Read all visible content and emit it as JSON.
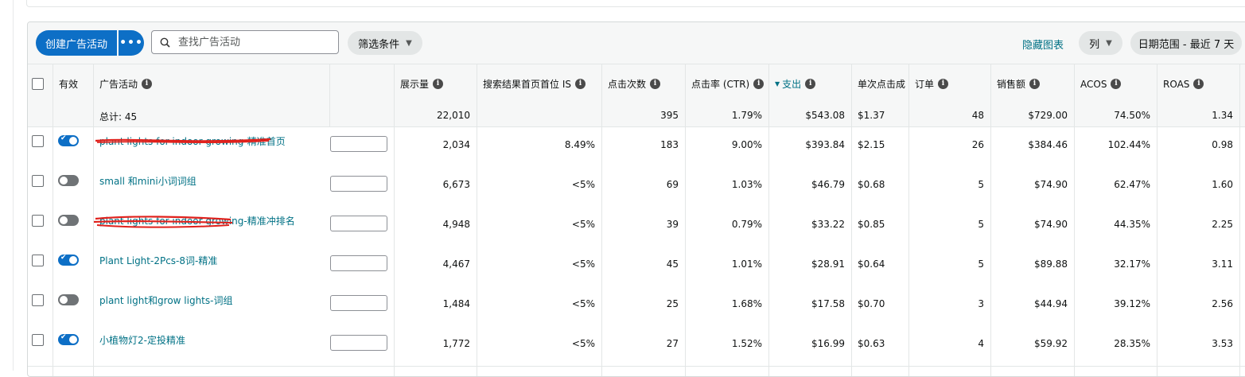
{
  "toolbar": {
    "create_label": "创建广告活动",
    "more_label": "•••",
    "search_placeholder": "查找广告活动",
    "filter_label": "筛选条件",
    "hide_chart_label": "隐藏图表",
    "columns_label": "列",
    "date_range_label": "日期范围 - 最近 7 天"
  },
  "table": {
    "headers": {
      "active": "有效",
      "campaign": "广告活动",
      "impressions": "展示量",
      "top_of_search_is": "搜索结果首页首位 IS",
      "clicks": "点击次数",
      "ctr": "点击率 (CTR)",
      "spend": "支出",
      "cpc": "单次点击成",
      "orders": "订单",
      "sales": "销售额",
      "acos": "ACOS",
      "roas": "ROAS"
    },
    "totals": {
      "label": "总计: 45",
      "impressions": "22,010",
      "clicks": "395",
      "ctr": "1.79%",
      "spend": "$543.08",
      "cpc": "$1.37",
      "orders": "48",
      "sales": "$729.00",
      "acos": "74.50%",
      "roas": "1.34"
    },
    "rows": [
      {
        "active": true,
        "name": "plant lights for indoor growing-精准首页",
        "impressions": "2,034",
        "is": "8.49%",
        "clicks": "183",
        "ctr": "9.00%",
        "spend": "$393.84",
        "cpc": "$2.15",
        "orders": "26",
        "sales": "$384.46",
        "acos": "102.44%",
        "roas": "0.98"
      },
      {
        "active": false,
        "name": "small 和mini小词词组",
        "impressions": "6,673",
        "is": "<5%",
        "clicks": "69",
        "ctr": "1.03%",
        "spend": "$46.79",
        "cpc": "$0.68",
        "orders": "5",
        "sales": "$74.90",
        "acos": "62.47%",
        "roas": "1.60"
      },
      {
        "active": false,
        "name": "plant lights for indoor growing-精准冲排名",
        "impressions": "4,948",
        "is": "<5%",
        "clicks": "39",
        "ctr": "0.79%",
        "spend": "$33.22",
        "cpc": "$0.85",
        "orders": "5",
        "sales": "$74.90",
        "acos": "44.35%",
        "roas": "2.25"
      },
      {
        "active": true,
        "name": "Plant Light-2Pcs-8词-精准",
        "impressions": "4,467",
        "is": "<5%",
        "clicks": "45",
        "ctr": "1.01%",
        "spend": "$28.91",
        "cpc": "$0.64",
        "orders": "5",
        "sales": "$89.88",
        "acos": "32.17%",
        "roas": "3.11"
      },
      {
        "active": false,
        "name": "plant light和grow lights-词组",
        "impressions": "1,484",
        "is": "<5%",
        "clicks": "25",
        "ctr": "1.68%",
        "spend": "$17.58",
        "cpc": "$0.70",
        "orders": "3",
        "sales": "$44.94",
        "acos": "39.12%",
        "roas": "2.56"
      },
      {
        "active": true,
        "name": "小植物灯2-定投精准",
        "impressions": "1,772",
        "is": "<5%",
        "clicks": "27",
        "ctr": "1.52%",
        "spend": "$16.99",
        "cpc": "$0.63",
        "orders": "4",
        "sales": "$59.92",
        "acos": "28.35%",
        "roas": "3.53"
      }
    ]
  },
  "colors": {
    "primary": "#0d6fc6",
    "link": "#007185",
    "scribble": "#e0201b"
  }
}
